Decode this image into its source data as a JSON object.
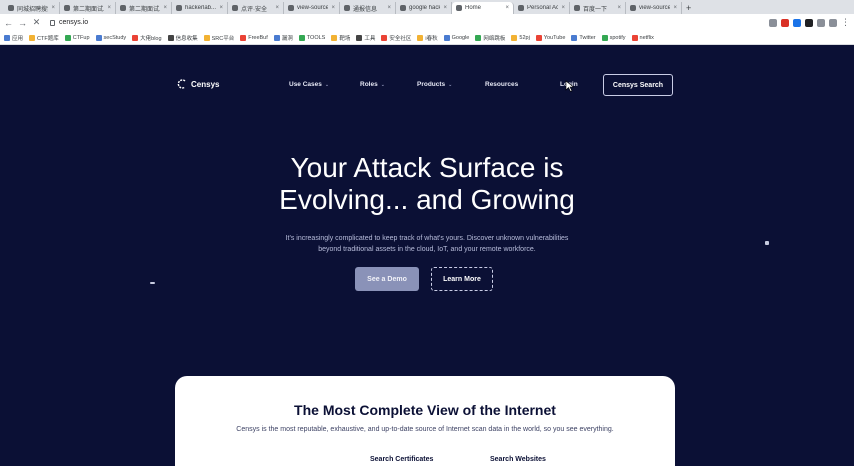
{
  "browser": {
    "tabs": [
      {
        "label": "同城招聘搜索"
      },
      {
        "label": "第二期面试..."
      },
      {
        "label": "第二期面试..."
      },
      {
        "label": "hackerlab..."
      },
      {
        "label": "点评·安全"
      },
      {
        "label": "view-source"
      },
      {
        "label": "通报信息"
      },
      {
        "label": "google hack"
      },
      {
        "label": "Home",
        "active": true
      },
      {
        "label": "Personal Acc"
      },
      {
        "label": "百度一下"
      },
      {
        "label": "view-source"
      }
    ],
    "new_tab_label": "+",
    "url": "censys.io",
    "bookmarks": [
      {
        "label": "应用"
      },
      {
        "label": "CTF题库"
      },
      {
        "label": "CTFup"
      },
      {
        "label": "secStudy"
      },
      {
        "label": "大佬blog"
      },
      {
        "label": "信息收集"
      },
      {
        "label": "SRC平台"
      },
      {
        "label": "FreeBuf"
      },
      {
        "label": "漏洞"
      },
      {
        "label": "TOOLS"
      },
      {
        "label": "靶场"
      },
      {
        "label": "工具"
      },
      {
        "label": "安全社区"
      },
      {
        "label": "i春秋"
      },
      {
        "label": "Google"
      },
      {
        "label": "网络跳板"
      },
      {
        "label": "52pj"
      },
      {
        "label": "YouTube"
      },
      {
        "label": "Twitter"
      },
      {
        "label": "spotify"
      },
      {
        "label": "netflix"
      }
    ]
  },
  "site": {
    "logo_text": "Censys",
    "nav": {
      "use_cases": "Use Cases",
      "roles": "Roles",
      "products": "Products",
      "resources": "Resources",
      "login": "Login",
      "search_cta": "Censys Search"
    },
    "hero": {
      "title_line1": "Your Attack Surface is",
      "title_line2": "Evolving... and Growing",
      "subtitle_line1": "It's increasingly complicated to keep track of what's yours. Discover unknown vulnerabilities",
      "subtitle_line2": "beyond traditional assets in the cloud, IoT, and your remote workforce.",
      "primary_button": "See a Demo",
      "secondary_button": "Learn More"
    },
    "card": {
      "title": "The Most Complete View of the Internet",
      "subtitle": "Censys is the most reputable, exhaustive, and up-to-date source of Internet scan data in the world, so you see everything.",
      "link_1": "Search Certificates",
      "link_2": "Search Websites"
    }
  }
}
